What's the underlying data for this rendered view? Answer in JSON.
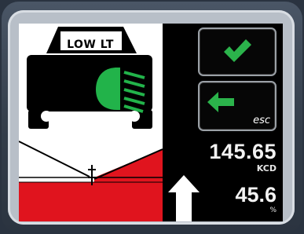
{
  "beam_mode": {
    "label": "LOW LT"
  },
  "controls": {
    "confirm": {
      "icon": "checkmark-icon"
    },
    "back": {
      "icon": "left-arrow-icon",
      "label": "esc"
    }
  },
  "readings": {
    "intensity": {
      "value": "145.65",
      "unit": "KCD"
    },
    "aim": {
      "value": "45.6",
      "unit": "%",
      "indicator_icon": "up-arrow-icon"
    }
  },
  "colors": {
    "screen_background": "#000000",
    "panel_background": "#ffffff",
    "headlamp_green": "#22b34a",
    "checkmark_green": "#2bb34b",
    "beam_pattern_red": "#e0141e",
    "text": "#f2f2f2"
  }
}
